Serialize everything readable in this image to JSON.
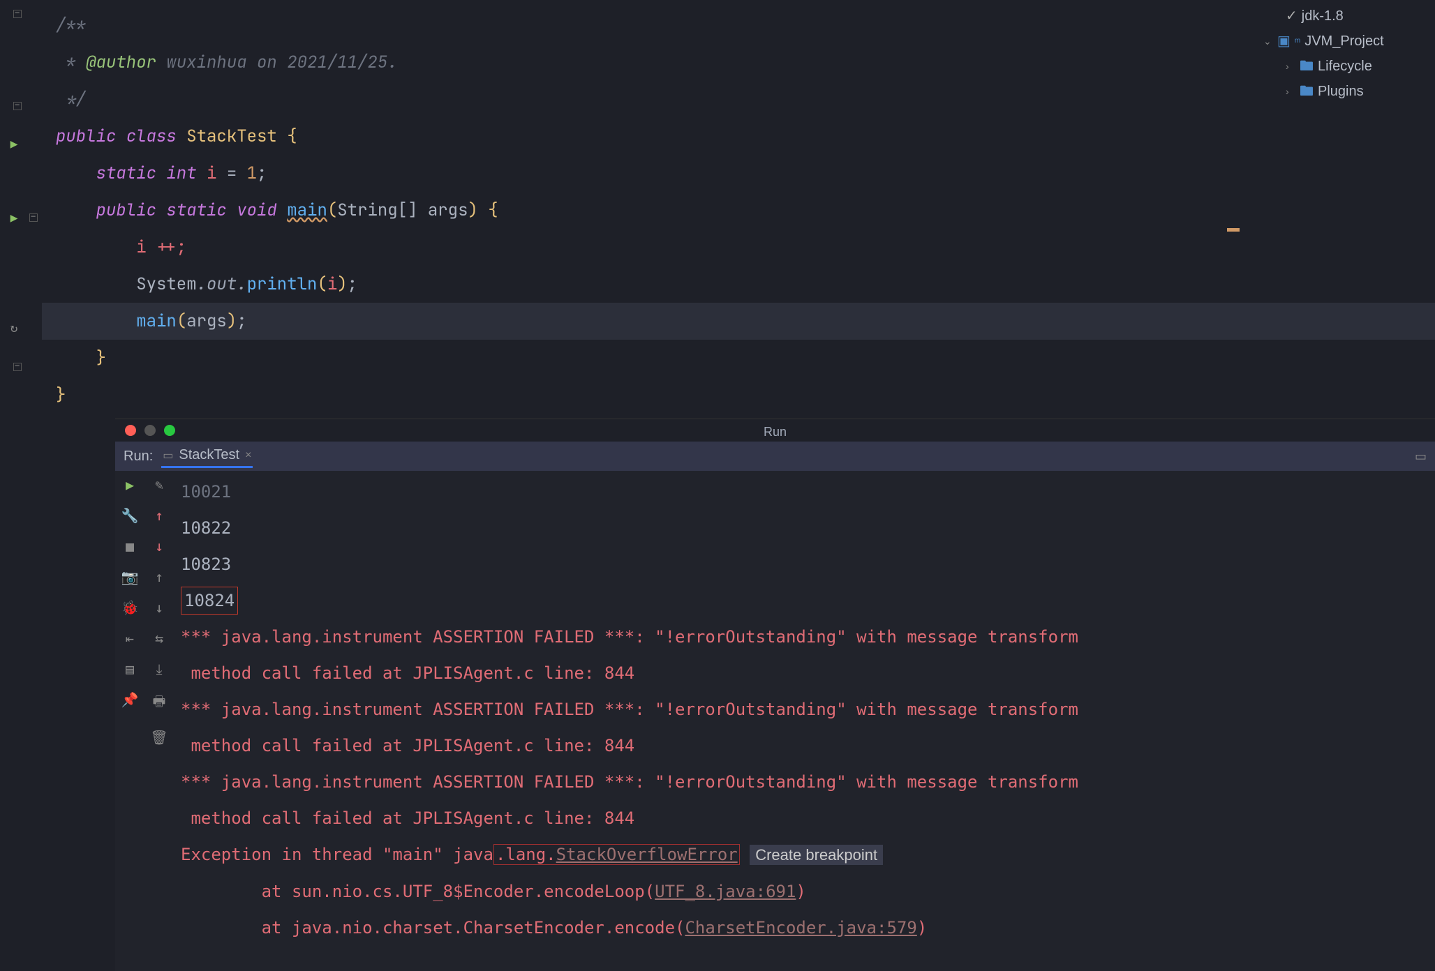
{
  "editor": {
    "doc_open": "/**",
    "doc_author_tag": "@author",
    "doc_author_text": " wuxinhua on 2021/11/25.",
    "doc_close": " */",
    "kw_public": "public",
    "kw_class": "class",
    "class_name": "StackTest",
    "kw_static": "static",
    "kw_int": "int",
    "field_i": "i",
    "eq": " = ",
    "one": "1",
    "kw_void": "void",
    "m_main": "main",
    "param_type": "String[]",
    "param_name": "args",
    "line_ipp": "i ++;",
    "sys": "System",
    "out": ".out.",
    "println": "println",
    "p_i": "i",
    "main_call": "main",
    "args_call": "args"
  },
  "tree": {
    "jdk": "jdk-1.8",
    "project": "JVM_Project",
    "lifecycle": "Lifecycle",
    "plugins": "Plugins"
  },
  "run": {
    "title": "Run",
    "label": "Run:",
    "tab": "StackTest"
  },
  "console": {
    "l0": "10021",
    "l1": "10822",
    "l2": "10823",
    "l3": "10824",
    "err1": "*** java.lang.instrument ASSERTION FAILED ***: \"!errorOutstanding\" with message transform",
    "err1b": " method call failed at JPLISAgent.c line: 844",
    "err2": "*** java.lang.instrument ASSERTION FAILED ***: \"!errorOutstanding\" with message transform",
    "err2b": " method call failed at JPLISAgent.c line: 844",
    "err3": "*** java.lang.instrument ASSERTION FAILED ***: \"!errorOutstanding\" with message transform",
    "err3b": " method call failed at JPLISAgent.c line: 844",
    "exc_pre": "Exception in thread \"main\" java",
    "exc_mid": ".lang.",
    "exc_err": "StackOverflowError",
    "bp": "Create breakpoint",
    "trace1_pre": "\tat sun.nio.cs.UTF_8$Encoder.encodeLoop(",
    "trace1_link": "UTF_8.java:691",
    "trace1_post": ")",
    "trace2_pre": "\tat java.nio.charset.CharsetEncoder.encode(",
    "trace2_link": "CharsetEncoder.java:579",
    "trace2_post": ")"
  }
}
